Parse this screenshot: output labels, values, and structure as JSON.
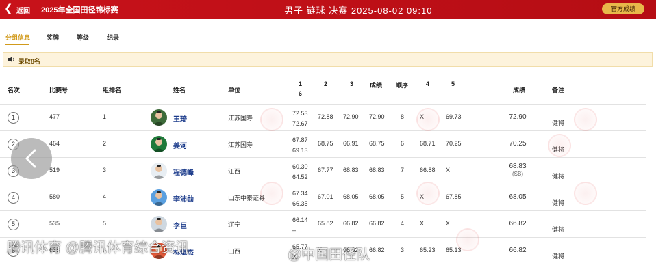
{
  "header": {
    "back_label": "返回",
    "event_title": "2025年全国田径锦标赛",
    "match_info": "男子 链球 决赛 2025-08-02 09:10",
    "official_button": "官方成绩"
  },
  "tabs": [
    {
      "label": "分组信息",
      "active": true
    },
    {
      "label": "奖牌",
      "active": false
    },
    {
      "label": "等级",
      "active": false
    },
    {
      "label": "纪录",
      "active": false
    }
  ],
  "notice": {
    "text": "录取8名"
  },
  "columns": {
    "rank": "名次",
    "bib": "比赛号",
    "order": "组排名",
    "name": "姓名",
    "unit": "单位",
    "a1": "1",
    "a6": "6",
    "a2": "2",
    "a3": "3",
    "mid_score": "成绩",
    "seq": "顺序",
    "a4": "4",
    "a5": "5",
    "final_score": "成绩",
    "note": "备注"
  },
  "rows": [
    {
      "rank": "1",
      "bib": "477",
      "order": "1",
      "name": "王琦",
      "unit": "江苏国寿",
      "a1": "72.53",
      "a6": "72.67",
      "a2": "72.88",
      "a3": "72.90",
      "mid": "72.90",
      "seq": "8",
      "a4": "X",
      "a5": "69.73",
      "final": "72.90",
      "sb": "",
      "note": "健将"
    },
    {
      "rank": "2",
      "bib": "464",
      "order": "2",
      "name": "姜河",
      "unit": "江苏国寿",
      "a1": "67.87",
      "a6": "69.13",
      "a2": "68.75",
      "a3": "66.91",
      "mid": "68.75",
      "seq": "6",
      "a4": "68.71",
      "a5": "70.25",
      "final": "70.25",
      "sb": "",
      "note": "健将"
    },
    {
      "rank": "3",
      "bib": "519",
      "order": "3",
      "name": "程德峰",
      "unit": "江西",
      "a1": "60.30",
      "a6": "64.52",
      "a2": "67.77",
      "a3": "68.83",
      "mid": "68.83",
      "seq": "7",
      "a4": "66.88",
      "a5": "X",
      "final": "68.83",
      "sb": "(SB)",
      "note": "健将"
    },
    {
      "rank": "4",
      "bib": "580",
      "order": "4",
      "name": "李沛勋",
      "unit": "山东中泰证券",
      "a1": "67.34",
      "a6": "66.35",
      "a2": "67.01",
      "a3": "68.05",
      "mid": "68.05",
      "seq": "5",
      "a4": "X",
      "a5": "67.85",
      "final": "68.05",
      "sb": "",
      "note": "健将"
    },
    {
      "rank": "5",
      "bib": "535",
      "order": "5",
      "name": "李巨",
      "unit": "辽宁",
      "a1": "66.14",
      "a6": "–",
      "a2": "65.82",
      "a3": "66.82",
      "mid": "66.82",
      "seq": "4",
      "a4": "X",
      "a5": "X",
      "final": "66.82",
      "sb": "",
      "note": "健将"
    },
    {
      "rank": "6",
      "bib": "638",
      "order": "6",
      "name": "林焜杰",
      "unit": "山西",
      "a1": "65.77",
      "a6": "X",
      "a2": "X",
      "a3": "66.82",
      "mid": "66.82",
      "seq": "3",
      "a4": "65.23",
      "a5": "65.13",
      "final": "66.82",
      "sb": "",
      "note": "健将"
    }
  ],
  "overlays": {
    "left": "腾讯体育 @腾讯体育综合资讯",
    "right": "@中国田径队"
  },
  "colors": {
    "header_red": "#c8121a",
    "accent_gold": "#d19a1b",
    "notice_bg": "#fdf3dc",
    "name_blue": "#1a3a8a"
  }
}
